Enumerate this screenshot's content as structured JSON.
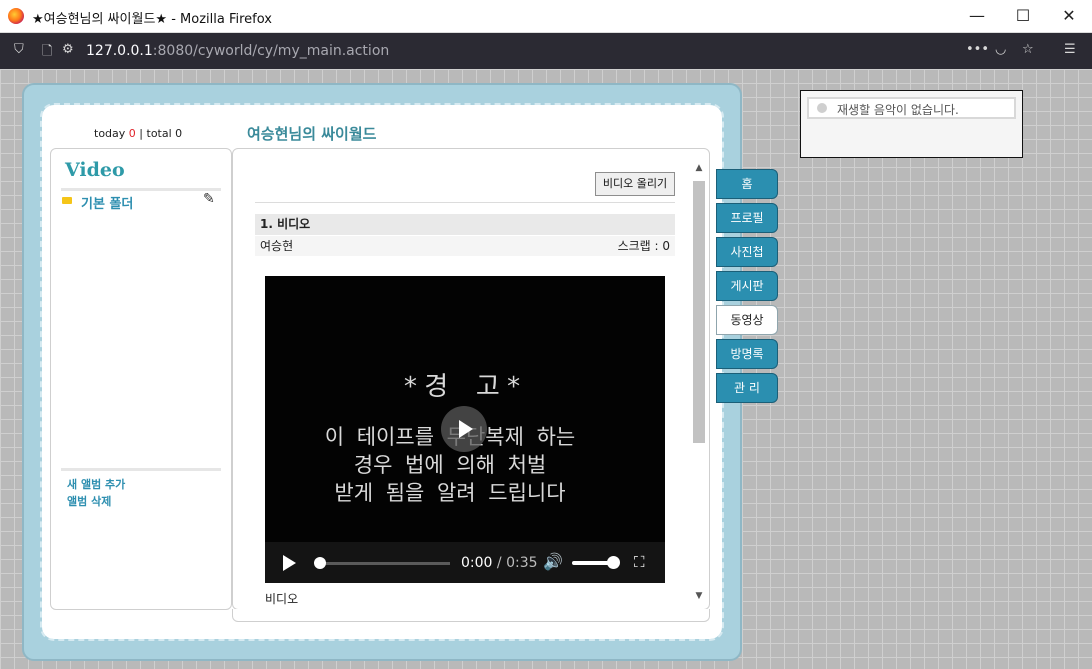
{
  "window": {
    "title": "★여승현님의 싸이월드★ - Mozilla Firefox",
    "minimize": "—",
    "maximize": "☐",
    "close": "✕"
  },
  "address_bar": {
    "url_host": "127.0.0.1",
    "url_rest": ":8080/cyworld/cy/my_main.action",
    "icons": [
      "shield-icon",
      "page-icon",
      "permissions-icon",
      "more-icon",
      "pocket-icon",
      "bookmark-star-icon",
      "menu-icon"
    ]
  },
  "counter": {
    "today_label": "today",
    "today_value": "0",
    "separator": "|",
    "total_label": "total",
    "total_value": "0"
  },
  "homepage_title": "여승현님의 싸이월드",
  "left_panel": {
    "heading": "Video",
    "folder": "기본 폴더",
    "links": [
      "새 앨범 추가",
      "앨범 삭제"
    ]
  },
  "content": {
    "upload_button": "비디오 올리기",
    "post_title": "1. 비디오",
    "author": "여승현",
    "scrap": "스크랩 : 0",
    "video_text": {
      "title": "*경 고*",
      "lines": [
        "이 테이프를 무단복제 하는",
        "경우 법에 의해 처벌",
        "받게 됨을 알려 드립니다"
      ]
    },
    "player": {
      "current_time": "0:00",
      "separator": "/",
      "duration": "0:35",
      "progress": 0.0,
      "volume": 1.0
    },
    "caption": "비디오"
  },
  "tabs": [
    {
      "label": "홈",
      "active": false
    },
    {
      "label": "프로필",
      "active": false
    },
    {
      "label": "사진첩",
      "active": false
    },
    {
      "label": "게시판",
      "active": false
    },
    {
      "label": "동영상",
      "active": true
    },
    {
      "label": "방명록",
      "active": false
    },
    {
      "label": "관 리",
      "active": false
    }
  ],
  "music_player": {
    "text": "재생할 음악이 없습니다."
  },
  "colors": {
    "accent": "#2b8fb0",
    "title_green": "#3a8a9a",
    "counter_red": "#e0262c",
    "frame": "#a9d1de"
  }
}
